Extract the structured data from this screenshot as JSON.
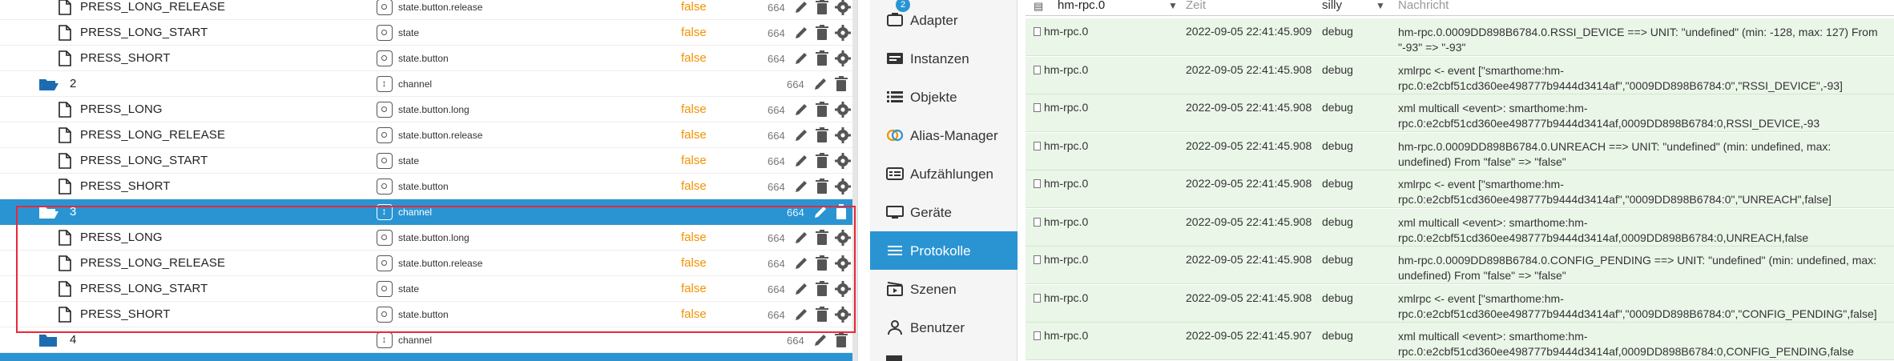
{
  "tree": {
    "rows": [
      {
        "name": "PRESS_LONG_RELEASE",
        "type": "state",
        "role_icon": "state-icon",
        "role": "state.button.release",
        "value": "false",
        "acl": "664"
      },
      {
        "name": "PRESS_LONG_START",
        "type": "state",
        "role_icon": "state-icon",
        "role": "state",
        "value": "false",
        "acl": "664"
      },
      {
        "name": "PRESS_SHORT",
        "type": "state",
        "role_icon": "state-icon",
        "role": "state.button",
        "value": "false",
        "acl": "664"
      },
      {
        "name": "2",
        "type": "channel",
        "role_icon": "channel-icon",
        "role": "channel",
        "value": "",
        "acl": "664"
      },
      {
        "name": "PRESS_LONG",
        "type": "state",
        "role_icon": "state-icon",
        "role": "state.button.long",
        "value": "false",
        "acl": "664"
      },
      {
        "name": "PRESS_LONG_RELEASE",
        "type": "state",
        "role_icon": "state-icon",
        "role": "state.button.release",
        "value": "false",
        "acl": "664"
      },
      {
        "name": "PRESS_LONG_START",
        "type": "state",
        "role_icon": "state-icon",
        "role": "state",
        "value": "false",
        "acl": "664"
      },
      {
        "name": "PRESS_SHORT",
        "type": "state",
        "role_icon": "state-icon",
        "role": "state.button",
        "value": "false",
        "acl": "664"
      },
      {
        "name": "3",
        "type": "channel",
        "role_icon": "channel-icon",
        "role": "channel",
        "value": "",
        "acl": "664",
        "selected": true
      },
      {
        "name": "PRESS_LONG",
        "type": "state",
        "role_icon": "state-icon",
        "role": "state.button.long",
        "value": "false",
        "acl": "664"
      },
      {
        "name": "PRESS_LONG_RELEASE",
        "type": "state",
        "role_icon": "state-icon",
        "role": "state.button.release",
        "value": "false",
        "acl": "664"
      },
      {
        "name": "PRESS_LONG_START",
        "type": "state",
        "role_icon": "state-icon",
        "role": "state",
        "value": "false",
        "acl": "664"
      },
      {
        "name": "PRESS_SHORT",
        "type": "state",
        "role_icon": "state-icon",
        "role": "state.button",
        "value": "false",
        "acl": "664"
      },
      {
        "name": "4",
        "type": "channel",
        "role_icon": "channel-icon",
        "role": "channel",
        "value": "",
        "acl": "664"
      }
    ]
  },
  "nav": {
    "items": [
      {
        "label": "Adapter",
        "icon": "adapter-icon",
        "badge": "2"
      },
      {
        "label": "Instanzen",
        "icon": "instances-icon"
      },
      {
        "label": "Objekte",
        "icon": "objects-icon"
      },
      {
        "label": "Alias-Manager",
        "icon": "alias-icon"
      },
      {
        "label": "Aufzählungen",
        "icon": "enums-icon"
      },
      {
        "label": "Geräte",
        "icon": "devices-icon"
      },
      {
        "label": "Protokolle",
        "icon": "logs-icon",
        "active": true
      },
      {
        "label": "Szenen",
        "icon": "scenes-icon"
      },
      {
        "label": "Benutzer",
        "icon": "users-icon"
      }
    ]
  },
  "logs": {
    "header": {
      "source": "hm-rpc.0",
      "time": "Zeit",
      "severity": "silly",
      "message": "Nachricht"
    },
    "rows": [
      {
        "source": "hm-rpc.0",
        "time": "2022-09-05 22:41:45.909",
        "severity": "debug",
        "message": "hm-rpc.0.0009DD898B6784.0.RSSI_DEVICE ==> UNIT: \"undefined\" (min: -128, max: 127) From \"-93\" => \"-93\""
      },
      {
        "source": "hm-rpc.0",
        "time": "2022-09-05 22:41:45.908",
        "severity": "debug",
        "message": "xmlrpc <- event [\"smarthome:hm-rpc.0:e2cbf51cd360ee498777b9444d3414af\",\"0009DD898B6784:0\",\"RSSI_DEVICE\",-93]"
      },
      {
        "source": "hm-rpc.0",
        "time": "2022-09-05 22:41:45.908",
        "severity": "debug",
        "message": "xml multicall <event>: smarthome:hm-rpc.0:e2cbf51cd360ee498777b9444d3414af,0009DD898B6784:0,RSSI_DEVICE,-93"
      },
      {
        "source": "hm-rpc.0",
        "time": "2022-09-05 22:41:45.908",
        "severity": "debug",
        "message": "hm-rpc.0.0009DD898B6784.0.UNREACH ==> UNIT: \"undefined\" (min: undefined, max: undefined) From \"false\" => \"false\""
      },
      {
        "source": "hm-rpc.0",
        "time": "2022-09-05 22:41:45.908",
        "severity": "debug",
        "message": "xmlrpc <- event [\"smarthome:hm-rpc.0:e2cbf51cd360ee498777b9444d3414af\",\"0009DD898B6784:0\",\"UNREACH\",false]"
      },
      {
        "source": "hm-rpc.0",
        "time": "2022-09-05 22:41:45.908",
        "severity": "debug",
        "message": "xml multicall <event>: smarthome:hm-rpc.0:e2cbf51cd360ee498777b9444d3414af,0009DD898B6784:0,UNREACH,false"
      },
      {
        "source": "hm-rpc.0",
        "time": "2022-09-05 22:41:45.908",
        "severity": "debug",
        "message": "hm-rpc.0.0009DD898B6784.0.CONFIG_PENDING ==> UNIT: \"undefined\" (min: undefined, max: undefined) From \"false\" => \"false\""
      },
      {
        "source": "hm-rpc.0",
        "time": "2022-09-05 22:41:45.908",
        "severity": "debug",
        "message": "xmlrpc <- event [\"smarthome:hm-rpc.0:e2cbf51cd360ee498777b9444d3414af\",\"0009DD898B6784:0\",\"CONFIG_PENDING\",false]"
      },
      {
        "source": "hm-rpc.0",
        "time": "2022-09-05 22:41:45.907",
        "severity": "debug",
        "message": "xml multicall <event>: smarthome:hm-rpc.0:e2cbf51cd360ee498777b9444d3414af,0009DD898B6784:0,CONFIG_PENDING,false"
      }
    ]
  },
  "colors": {
    "accent": "#2a94d2",
    "value": "#f39200",
    "log_row": "#eaf6e8",
    "highlight": "#e8283a"
  }
}
